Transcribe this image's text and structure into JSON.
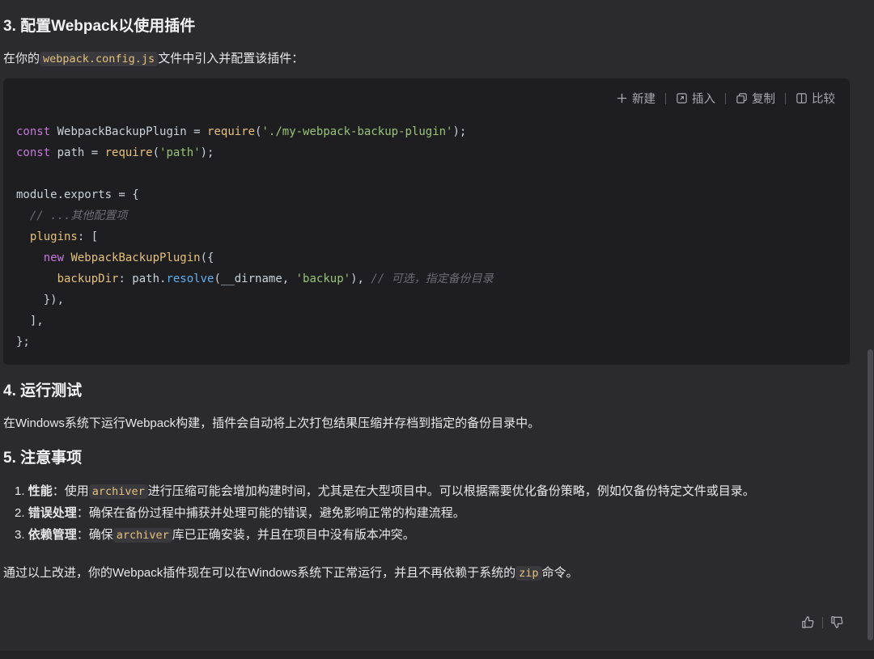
{
  "section3": {
    "heading": "3. 配置Webpack以使用插件",
    "intro_prefix": "在你的",
    "intro_code": "webpack.config.js",
    "intro_suffix": "文件中引入并配置该插件："
  },
  "code_toolbar": {
    "new_label": "新建",
    "insert_label": "插入",
    "copy_label": "复制",
    "compare_label": "比较"
  },
  "code_lines": {
    "l1_kw": "const",
    "l1_name": " WebpackBackupPlugin = ",
    "l1_fn": "require",
    "l1_open": "(",
    "l1_str": "'./my-webpack-backup-plugin'",
    "l1_close": ");",
    "l2_kw": "const",
    "l2_name": " path = ",
    "l2_fn": "require",
    "l2_open": "(",
    "l2_str": "'path'",
    "l2_close": ");",
    "l4": "module.exports = {",
    "l5_cmt": "  // ...其他配置项",
    "l6_indent": "  ",
    "l6_prop": "plugins",
    "l6_rest": ": [",
    "l7_indent": "    ",
    "l7_kw": "new",
    "l7_fn": " WebpackBackupPlugin",
    "l7_rest": "({",
    "l8_indent": "      ",
    "l8_prop": "backupDir",
    "l8_mid": ": path.",
    "l8_fn": "resolve",
    "l8_args": "(__dirname, ",
    "l8_str": "'backup'",
    "l8_close": "), ",
    "l8_cmt": "// 可选，指定备份目录",
    "l9": "    }),",
    "l10": "  ],",
    "l11": "};"
  },
  "section4": {
    "heading": "4. 运行测试",
    "text": "在Windows系统下运行Webpack构建，插件会自动将上次打包结果压缩并存档到指定的备份目录中。"
  },
  "section5": {
    "heading": "5. 注意事项",
    "items": [
      {
        "num": "1.",
        "bold": "性能",
        "pre": "：使用",
        "code": "archiver",
        "post": "进行压缩可能会增加构建时间，尤其是在大型项目中。可以根据需要优化备份策略，例如仅备份特定文件或目录。"
      },
      {
        "num": "2.",
        "bold": "错误处理",
        "pre": "：确保在备份过程中捕获并处理可能的错误，避免影响正常的构建流程。",
        "code": "",
        "post": ""
      },
      {
        "num": "3.",
        "bold": "依赖管理",
        "pre": "：确保",
        "code": "archiver",
        "post": "库已正确安装，并且在项目中没有版本冲突。"
      }
    ]
  },
  "conclusion": {
    "prefix": "通过以上改进，你的Webpack插件现在可以在Windows系统下正常运行，并且不再依赖于系统的",
    "code": "zip",
    "suffix": "命令。"
  },
  "icons": {
    "new": "plus-icon",
    "insert": "insert-icon",
    "copy": "copy-icon",
    "compare": "compare-icon",
    "like": "thumbs-up-icon",
    "dislike": "thumbs-down-icon"
  }
}
